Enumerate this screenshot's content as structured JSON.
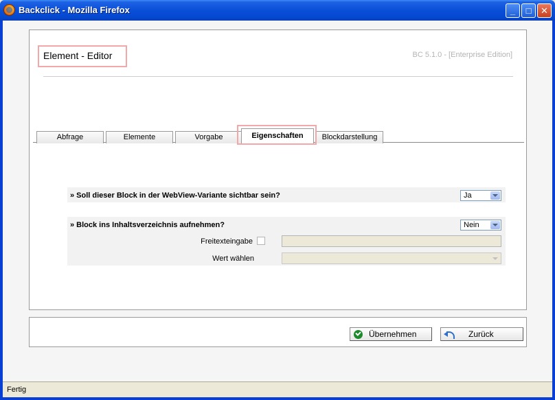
{
  "window": {
    "title": "Backclick - Mozilla Firefox",
    "minimize": "_",
    "maximize": "□",
    "close": "✕"
  },
  "header": {
    "page_title": "Element - Editor",
    "version": "BC 5.1.0 - [Enterprise Edition]"
  },
  "tabs": [
    {
      "label": "Abfrage"
    },
    {
      "label": "Elemente"
    },
    {
      "label": "Vorgabe"
    },
    {
      "label": "Eigenschaften",
      "active": true
    },
    {
      "label": "Blockdarstellung"
    }
  ],
  "form": {
    "q1": {
      "label": "» Soll dieser Block in der WebView-Variante sichtbar sein?",
      "value": "Ja"
    },
    "q2": {
      "label": "» Block ins Inhaltsverzeichnis aufnehmen?",
      "value": "Nein",
      "freitext_label": "Freitexteingabe",
      "wert_label": "Wert wählen"
    }
  },
  "buttons": {
    "apply": "Übernehmen",
    "back": "Zurück"
  },
  "status": {
    "text": "Fertig"
  }
}
